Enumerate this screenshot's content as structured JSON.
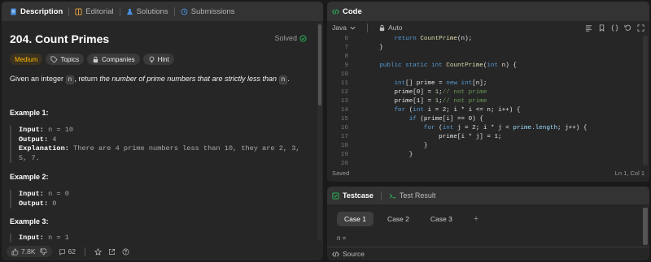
{
  "left_tabs": {
    "description": "Description",
    "editorial": "Editorial",
    "solutions": "Solutions",
    "submissions": "Submissions"
  },
  "problem": {
    "title": "204. Count Primes",
    "solved": "Solved",
    "badges": {
      "difficulty": "Medium",
      "topics": "Topics",
      "companies": "Companies",
      "hint": "Hint"
    },
    "desc_pre": "Given an integer ",
    "desc_var": "n",
    "desc_mid": ", return ",
    "desc_em": "the number of prime numbers that are strictly less than",
    "desc_var2": "n",
    "desc_end": ".",
    "examples": [
      {
        "header": "Example 1:",
        "input_label": "Input:",
        "input": " n = 10",
        "output_label": "Output:",
        "output": " 4",
        "expl_label": "Explanation:",
        "explanation": " There are 4 prime numbers less than 10, they are 2, 3, 5, 7."
      },
      {
        "header": "Example 2:",
        "input_label": "Input:",
        "input": " n = 0",
        "output_label": "Output:",
        "output": " 0"
      },
      {
        "header": "Example 3:",
        "input_label": "Input:",
        "input": " n = 1"
      }
    ]
  },
  "bottom_bar": {
    "likes": "7.8K",
    "comments": "62"
  },
  "code_panel": {
    "title": "Code",
    "language": "Java",
    "autosave": "Auto",
    "status": "Saved",
    "cursor": "Ln 1, Col 1"
  },
  "code_lines": [
    {
      "n": "6"
    },
    {
      "n": "7"
    },
    {
      "n": "8"
    },
    {
      "n": "9"
    },
    {
      "n": "10"
    },
    {
      "n": "11"
    },
    {
      "n": "12"
    },
    {
      "n": "13"
    },
    {
      "n": "14"
    },
    {
      "n": "15"
    },
    {
      "n": "16"
    },
    {
      "n": "17"
    },
    {
      "n": "18"
    },
    {
      "n": "19"
    },
    {
      "n": "20"
    }
  ],
  "code_text": {
    "l6_kw": "return",
    "l6_fn": "CountPrime",
    "l6_rest": "(n);",
    "l7": "}",
    "l9_kw": "public static int",
    "l9_fn": "CountPrime",
    "l9_p1": "(",
    "l9_kw2": "int",
    "l9_p2": " n) {",
    "l11_kw": "int",
    "l11_a": "[] prime = ",
    "l11_kw2": "new int",
    "l11_b": "[n];",
    "l12_a": "prime[0] = ",
    "l12_num": "1",
    "l12_b": ";",
    "l12_cm": "// not prime",
    "l13_a": "prime[1] = ",
    "l13_num": "1",
    "l13_b": ";",
    "l13_cm": "// not prime",
    "l14_kw": "for",
    "l14_a": " (",
    "l14_kw2": "int",
    "l14_b": " i = 2; i * i <= n; i++) {",
    "l15_kw": "if",
    "l15_a": " (prime[i] == 0) {",
    "l16_kw": "for",
    "l16_a": " (",
    "l16_kw2": "int",
    "l16_b": " j = 2; i * j < ",
    "l16_fld": "prime.length",
    "l16_c": "; j++) {",
    "l17": "prime[i * j] = 1;",
    "l18": "}",
    "l19": "}"
  },
  "test_panel": {
    "testcase": "Testcase",
    "test_result": "Test Result",
    "cases": [
      "Case 1",
      "Case 2",
      "Case 3"
    ],
    "add": "+",
    "input_label": "n =",
    "source": "Source"
  }
}
